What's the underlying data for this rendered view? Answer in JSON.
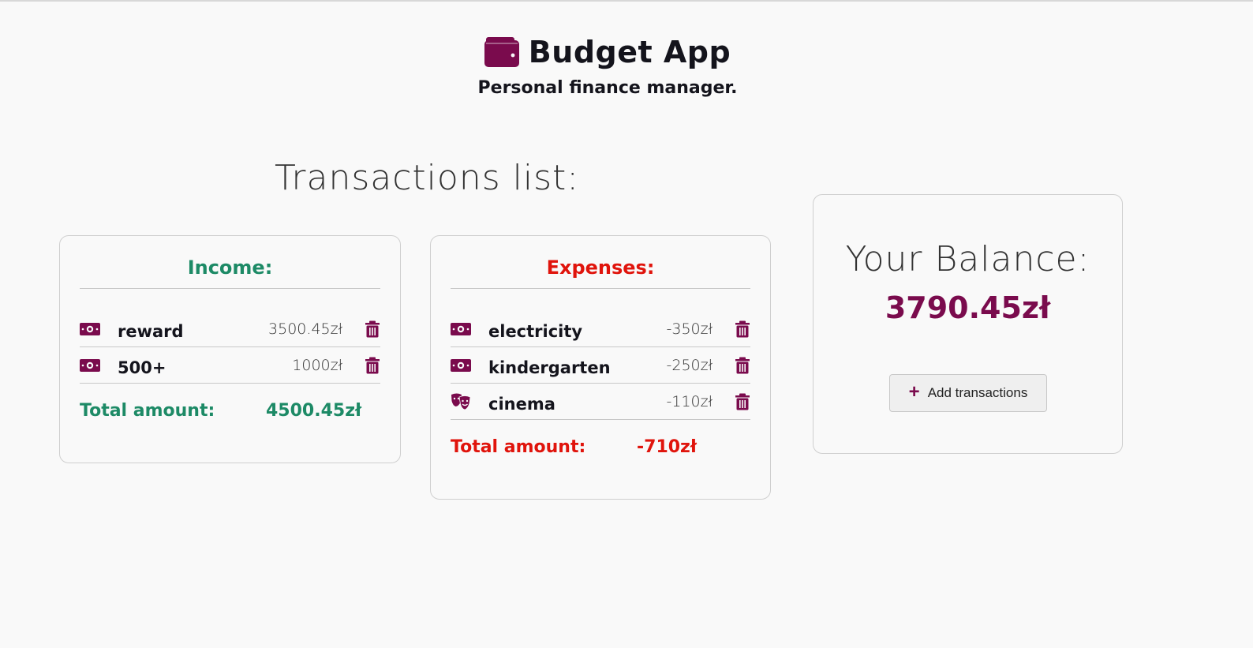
{
  "header": {
    "title": "Budget App",
    "subtitle": "Personal finance manager.",
    "icon": "wallet-icon"
  },
  "transactions_title": "Transactions list:",
  "income": {
    "heading": "Income:",
    "items": [
      {
        "icon": "money-bill-icon",
        "name": "reward",
        "amount": "3500.45zł"
      },
      {
        "icon": "money-bill-icon",
        "name": "500+",
        "amount": "1000zł"
      }
    ],
    "total_label": "Total amount:",
    "total_value": "4500.45zł"
  },
  "expenses": {
    "heading": "Expenses:",
    "items": [
      {
        "icon": "money-bill-icon",
        "name": "electricity",
        "amount": "-350zł"
      },
      {
        "icon": "money-bill-icon",
        "name": "kindergarten",
        "amount": "-250zł"
      },
      {
        "icon": "theater-masks-icon",
        "name": "cinema",
        "amount": "-110zł"
      }
    ],
    "total_label": "Total amount:",
    "total_value": "-710zł"
  },
  "balance": {
    "title": "Your Balance:",
    "value": "3790.45zł",
    "add_button_label": "Add transactions"
  },
  "colors": {
    "accent": "#7a0b4d",
    "income": "#1d8a66",
    "expense": "#e0140c",
    "background": "#f9f9f9"
  }
}
